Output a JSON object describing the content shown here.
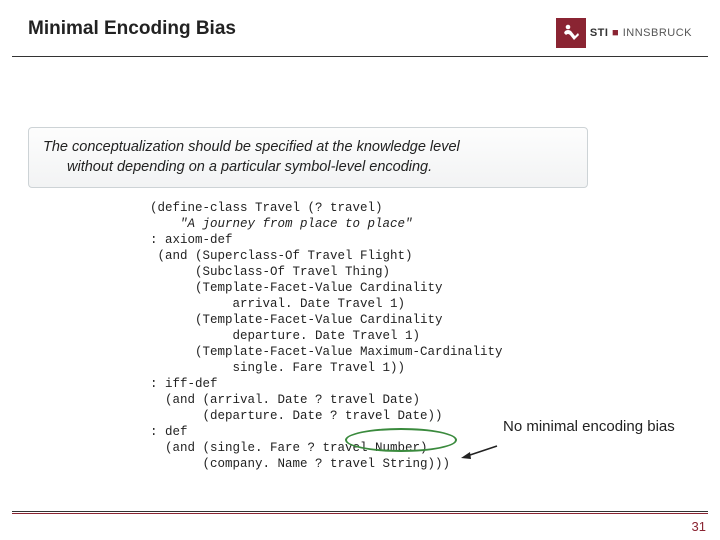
{
  "header": {
    "title": "Minimal Encoding Bias",
    "logo": {
      "text_bold": "STI",
      "text_rest": "INNSBRUCK"
    }
  },
  "quote": {
    "line1": "The conceptualization should be specified at the knowledge level",
    "line2": "without depending on a particular symbol-level encoding."
  },
  "code": {
    "l01": "(define-class Travel (? travel)",
    "l02_a": "    ",
    "l02_b": "\"A journey from place to place\"",
    "l03": ": axiom-def",
    "l04": " (and (Superclass-Of Travel Flight)",
    "l05": "      (Subclass-Of Travel Thing)",
    "l06": "      (Template-Facet-Value Cardinality",
    "l07": "           arrival. Date Travel 1)",
    "l08": "      (Template-Facet-Value Cardinality",
    "l09": "           departure. Date Travel 1)",
    "l10": "      (Template-Facet-Value Maximum-Cardinality",
    "l11": "           single. Fare Travel 1))",
    "l12": ": iff-def",
    "l13": "  (and (arrival. Date ? travel Date)",
    "l14": "       (departure. Date ? travel Date))",
    "l15": ": def",
    "l16": "  (and (single. Fare ? travel Number)",
    "l17": "       (company. Name ? travel String)))"
  },
  "annotation": {
    "text": "No minimal encoding bias"
  },
  "page_number": "31"
}
